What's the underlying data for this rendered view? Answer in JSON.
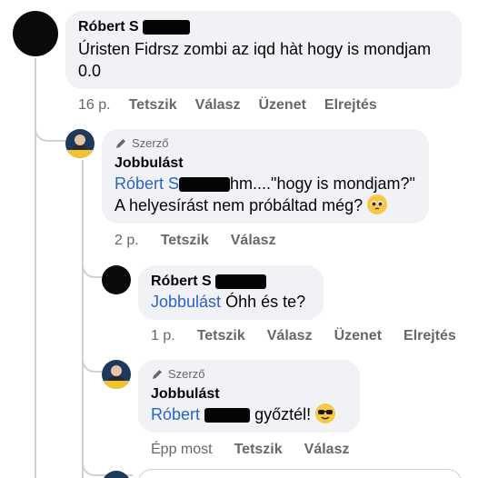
{
  "comments": [
    {
      "author": "Róbert S",
      "text": "Úristen Fidrsz zombi az iqd hàt hogy is mondjam 0.0",
      "time": "16 p.",
      "actions": [
        "Tetszik",
        "Válasz",
        "Üzenet",
        "Elrejtés"
      ]
    },
    {
      "badge": "Szerző",
      "author": "Jobbulást",
      "mention": "Róbert S",
      "text_line1": "hm....\"hogy is mondjam?\"",
      "text_line2": "A helyesírást nem próbáltad még?",
      "emoji": "pleading-face",
      "time": "2 p.",
      "actions": [
        "Tetszik",
        "Válasz"
      ]
    },
    {
      "author": "Róbert S",
      "mention": "Jobbulást",
      "text": "Óhh és te?",
      "time": "1 p.",
      "actions": [
        "Tetszik",
        "Válasz",
        "Üzenet",
        "Elrejtés"
      ]
    },
    {
      "badge": "Szerző",
      "author": "Jobbulást",
      "mention": "Róbert",
      "text": "győztél!",
      "emoji": "sunglasses-face",
      "time": "Épp most",
      "actions": [
        "Tetszik",
        "Válasz"
      ]
    }
  ],
  "colors": {
    "bubble": "#f0f2f5",
    "mention": "#2c64c0",
    "meta": "#65676b",
    "thread_line": "#ced0d4"
  }
}
